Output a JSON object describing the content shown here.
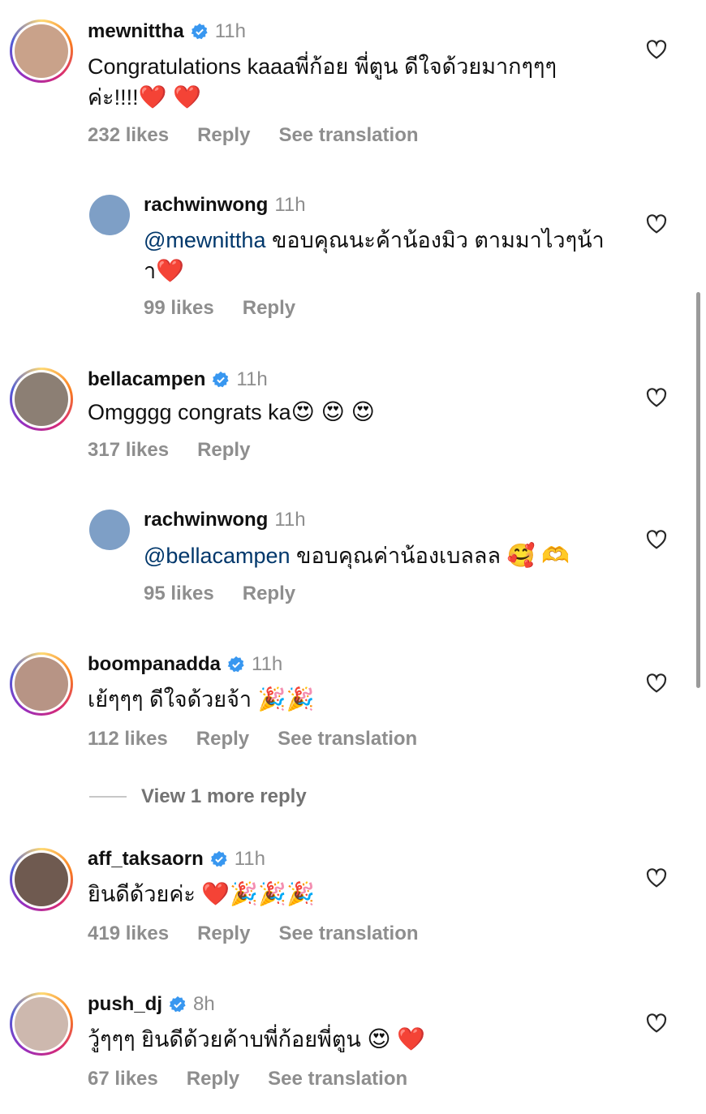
{
  "comments": [
    {
      "username": "mewnittha",
      "verified": true,
      "time": "11h",
      "text": "Congratulations kaaaพี่ก้อย พี่ตูน ดีใจด้วยมากๆๆๆ\nค่ะ!!!!",
      "emojis": "❤️ ❤️",
      "likes": "232 likes",
      "reply": "Reply",
      "translate": "See translation",
      "avatar_color": "#c9a28a"
    },
    {
      "username": "rachwinwong",
      "verified": false,
      "time": "11h",
      "mention": "@mewnittha",
      "text": " ขอบคุณนะค้าน้องมิว ตามมาไวๆน้า\nา",
      "emojis": "❤️",
      "likes": "99 likes",
      "reply": "Reply",
      "avatar_color": "#7e9fc6"
    },
    {
      "username": "bellacampen",
      "verified": true,
      "time": "11h",
      "text": "Omgggg congrats ka",
      "emojis": "😍 😍 😍",
      "likes": "317 likes",
      "reply": "Reply",
      "avatar_color": "#8c7f74"
    },
    {
      "username": "rachwinwong",
      "verified": false,
      "time": "11h",
      "mention": "@bellacampen",
      "text": " ขอบคุณค่าน้องเบลลล ",
      "emojis": "🥰 🫶",
      "likes": "95 likes",
      "reply": "Reply",
      "avatar_color": "#7e9fc6"
    },
    {
      "username": "boompanadda",
      "verified": true,
      "time": "11h",
      "text": "เย้ๆๆๆ ดีใจด้วยจ้า ",
      "emojis": "🎉🎉",
      "likes": "112 likes",
      "reply": "Reply",
      "translate": "See translation",
      "avatar_color": "#b79485"
    },
    {
      "username": "aff_taksaorn",
      "verified": true,
      "time": "11h",
      "text": "ยินดีด้วยค่ะ ",
      "emojis": "❤️🎉🎉🎉",
      "likes": "419 likes",
      "reply": "Reply",
      "translate": "See translation",
      "avatar_color": "#6f5a50"
    },
    {
      "username": "push_dj",
      "verified": true,
      "time": "8h",
      "text": "วู้ๆๆๆ ยินดีด้วยค้าบพี่ก้อยพี่ตูน ",
      "emojis": "😍 ❤️",
      "likes": "67 likes",
      "reply": "Reply",
      "translate": "See translation",
      "avatar_color": "#cdb8ae"
    }
  ],
  "view_more": "View 1 more reply",
  "colors": {
    "verified": "#3897f0",
    "mention": "#00376b",
    "secondary": "#8e8e8e"
  }
}
